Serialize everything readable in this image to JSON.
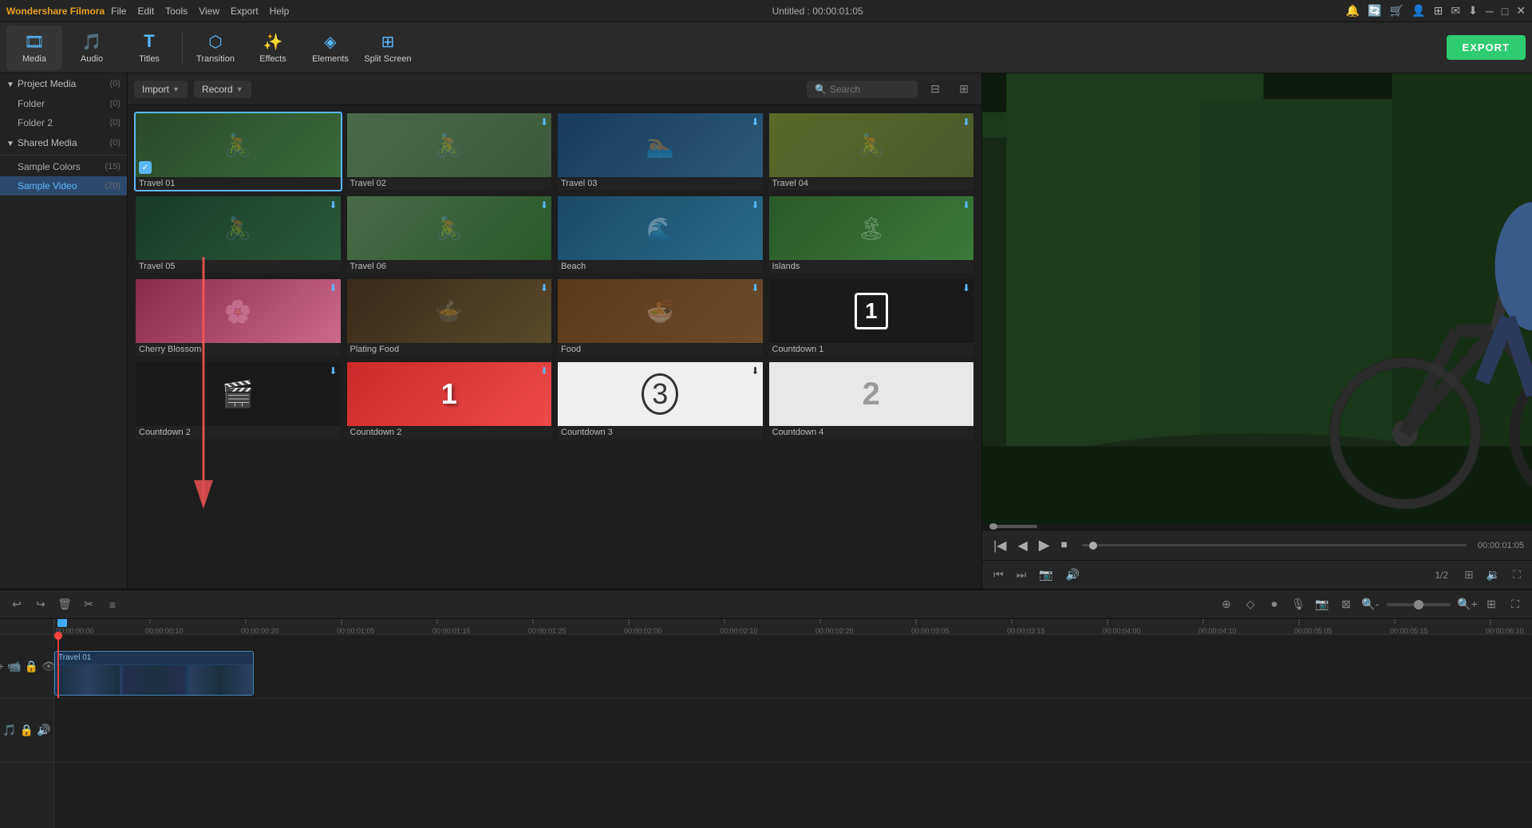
{
  "app": {
    "title": "Wondershare Filmora",
    "window_title": "Untitled : 00:00:01:05"
  },
  "menu": {
    "items": [
      "File",
      "Edit",
      "Tools",
      "View",
      "Export",
      "Help"
    ]
  },
  "toolbar": {
    "export_label": "EXPORT",
    "tools": [
      {
        "id": "media",
        "label": "Media",
        "icon": "🎞"
      },
      {
        "id": "audio",
        "label": "Audio",
        "icon": "🎵"
      },
      {
        "id": "titles",
        "label": "Titles",
        "icon": "T"
      },
      {
        "id": "transition",
        "label": "Transition",
        "icon": "⬡"
      },
      {
        "id": "effects",
        "label": "Effects",
        "icon": "✨"
      },
      {
        "id": "elements",
        "label": "Elements",
        "icon": "◈"
      },
      {
        "id": "splitscreen",
        "label": "Split Screen",
        "icon": "⊞"
      }
    ]
  },
  "sidebar": {
    "sections": [
      {
        "id": "project-media",
        "label": "Project Media",
        "count": 0,
        "expanded": true,
        "items": [
          {
            "label": "Folder",
            "count": 0
          },
          {
            "label": "Folder 2",
            "count": 0
          }
        ]
      },
      {
        "id": "shared-media",
        "label": "Shared Media",
        "count": 0,
        "expanded": true,
        "items": []
      }
    ],
    "standalone_items": [
      {
        "label": "Sample Colors",
        "count": 15
      },
      {
        "label": "Sample Video",
        "count": 20,
        "active": true
      }
    ]
  },
  "media_panel": {
    "import_label": "Import",
    "record_label": "Record",
    "search_placeholder": "Search",
    "items": [
      {
        "id": "travel01",
        "label": "Travel 01",
        "thumb_class": "thumb-travel01",
        "selected": true,
        "has_check": true
      },
      {
        "id": "travel02",
        "label": "Travel 02",
        "thumb_class": "thumb-travel02",
        "has_download": true
      },
      {
        "id": "travel03",
        "label": "Travel 03",
        "thumb_class": "thumb-travel03",
        "has_download": true
      },
      {
        "id": "travel04",
        "label": "Travel 04",
        "thumb_class": "thumb-travel04",
        "has_download": true
      },
      {
        "id": "travel05",
        "label": "Travel 05",
        "thumb_class": "thumb-travel05",
        "has_download": true
      },
      {
        "id": "travel06",
        "label": "Travel 06",
        "thumb_class": "thumb-travel06",
        "has_download": true
      },
      {
        "id": "beach",
        "label": "Beach",
        "thumb_class": "thumb-beach",
        "has_download": true
      },
      {
        "id": "islands",
        "label": "Islands",
        "thumb_class": "thumb-islands",
        "has_download": true
      },
      {
        "id": "cherry-blossom",
        "label": "Cherry Blossom",
        "thumb_class": "thumb-cherry",
        "has_download": true
      },
      {
        "id": "plating-food",
        "label": "Plating Food",
        "thumb_class": "thumb-plating",
        "has_download": true
      },
      {
        "id": "food",
        "label": "Food",
        "thumb_class": "thumb-food",
        "has_download": true
      },
      {
        "id": "countdown1",
        "label": "Countdown 1",
        "thumb_class": "thumb-countdown1",
        "has_download": true
      },
      {
        "id": "countdown2a",
        "label": "Countdown 2",
        "thumb_class": "thumb-countdown2a",
        "has_download": true
      },
      {
        "id": "countdown2b",
        "label": "Countdown 2",
        "thumb_class": "thumb-countdown2b",
        "has_download": true
      },
      {
        "id": "countdown3",
        "label": "Countdown 3",
        "thumb_class": "thumb-countdown3",
        "has_download": true
      },
      {
        "id": "countdown4",
        "label": "Countdown 4",
        "thumb_class": "thumb-countdown4",
        "has_download": false
      }
    ]
  },
  "preview": {
    "time_current": "00:00:01:05",
    "time_total": "00:00:01:05",
    "fraction": "1/2",
    "timeline_time": "00:00:00:00",
    "scrubber_position": "2%"
  },
  "timeline": {
    "total_duration": "00:00:06:10",
    "clip_label": "Travel 01",
    "markers": [
      "00:00:00:00",
      "00:00:00:10",
      "00:00:00:20",
      "00:00:01:05",
      "00:00:01:15",
      "00:00:01:25",
      "00:00:02:00",
      "00:00:02:10",
      "00:00:02:20",
      "00:00:03:05",
      "00:00:03:15",
      "00:00:04:00",
      "00:00:04:10",
      "00:00:05:05",
      "00:00:05:15",
      "00:00:06:10"
    ]
  },
  "icons": {
    "play": "▶",
    "pause": "⏸",
    "stop": "⏹",
    "prev_frame": "⏮",
    "next_frame": "⏭",
    "volume": "🔊",
    "fullscreen": "⛶",
    "search": "🔍",
    "filter": "⊟",
    "grid": "⊞",
    "download": "⬇",
    "check": "✓",
    "chevron_right": "▶",
    "chevron_down": "▼",
    "collapse": "◀"
  }
}
